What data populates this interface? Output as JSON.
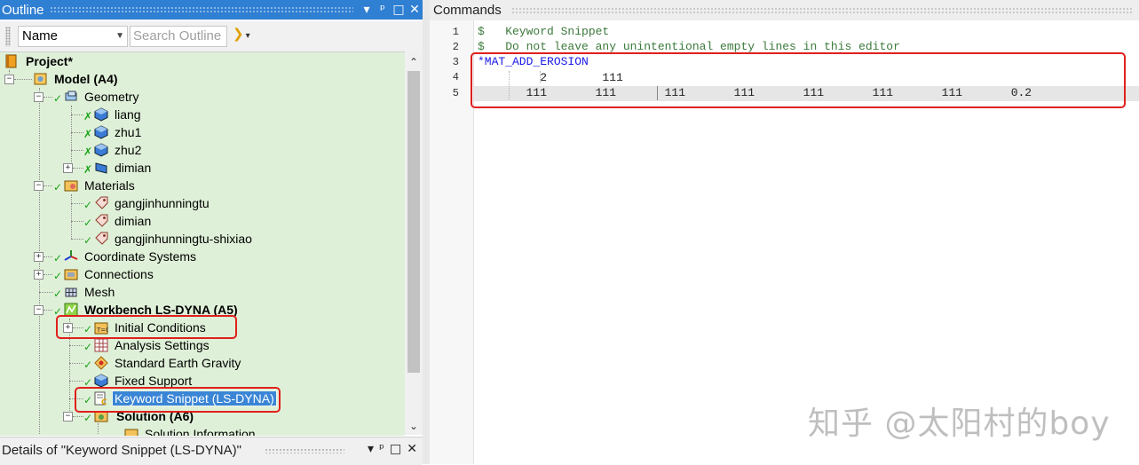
{
  "outline": {
    "title": "Outline",
    "header_buttons": [
      "▾",
      "ᵖ",
      "□",
      "✕"
    ],
    "toolbar": {
      "sort_value": "Name",
      "search_placeholder": "Search Outline"
    },
    "tree": [
      {
        "label": "Project*",
        "bold": true
      },
      {
        "label": "Model (A4)",
        "bold": true
      },
      {
        "label": "Geometry"
      },
      {
        "label": "liang"
      },
      {
        "label": "zhu1"
      },
      {
        "label": "zhu2"
      },
      {
        "label": "dimian"
      },
      {
        "label": "Materials"
      },
      {
        "label": "gangjinhunningtu"
      },
      {
        "label": "dimian"
      },
      {
        "label": "gangjinhunningtu-shixiao"
      },
      {
        "label": "Coordinate Systems"
      },
      {
        "label": "Connections"
      },
      {
        "label": "Mesh"
      },
      {
        "label": "Workbench LS-DYNA (A5)",
        "bold": true
      },
      {
        "label": "Initial Conditions"
      },
      {
        "label": "Analysis Settings"
      },
      {
        "label": "Standard Earth Gravity"
      },
      {
        "label": "Fixed Support"
      },
      {
        "label": "Keyword Snippet (LS-DYNA)",
        "selected": true
      },
      {
        "label": "Solution (A6)",
        "bold": true
      },
      {
        "label": "Solution Information"
      }
    ]
  },
  "details": {
    "title": "Details of \"Keyword Snippet (LS-DYNA)\""
  },
  "commands": {
    "title": "Commands",
    "lines": [
      {
        "num": "1",
        "text": "$   Keyword Snippet"
      },
      {
        "num": "2",
        "text": "$   Do not leave any unintentional empty lines in this editor"
      },
      {
        "num": "3",
        "text": "*MAT_ADD_EROSION"
      },
      {
        "num": "4",
        "text": "         2        111"
      },
      {
        "num": "5",
        "text": "       111       111       111       111       111       111       111       0.2"
      }
    ]
  },
  "watermark": "知乎 @太阳村的boy",
  "colors": {
    "outline_header": "#2f7fd3",
    "tree_background": "#dff0d8",
    "selection": "#3a85d6",
    "annotation_red": "#e0201c",
    "comment_green": "#3c7a3c",
    "keyword_blue": "#1a1ae6"
  }
}
